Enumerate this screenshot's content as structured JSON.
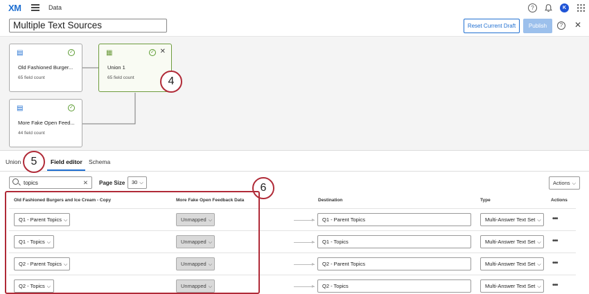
{
  "topbar": {
    "logo": "XM",
    "section": "Data",
    "avatar_initial": "K"
  },
  "header": {
    "title": "Multiple Text Sources",
    "reset_label": "Reset Current Draft",
    "publish_label": "Publish"
  },
  "nodes": [
    {
      "title": "Old Fashioned Burger...",
      "sub": "65 field count"
    },
    {
      "title": "Union 1",
      "sub": "65 field count"
    },
    {
      "title": "More Fake Open Feed...",
      "sub": "44 field count"
    }
  ],
  "callouts": {
    "c4": "4",
    "c5": "5",
    "c6": "6"
  },
  "tabs": {
    "union": "Union",
    "field_editor": "Field editor",
    "schema": "Schema"
  },
  "toolbar": {
    "search_value": "topics",
    "page_size_label": "Page Size",
    "page_size_value": "30",
    "actions_label": "Actions"
  },
  "table": {
    "headers": {
      "source1": "Old Fashioned Burgers and Ice Cream - Copy",
      "source2": "More Fake Open Feedback Data",
      "destination": "Destination",
      "type": "Type",
      "actions": "Actions"
    },
    "rows": [
      {
        "source1": "Q1 - Parent Topics",
        "source2": "Unmapped",
        "destination": "Q1 - Parent Topics",
        "type": "Multi-Answer Text Set"
      },
      {
        "source1": "Q1 - Topics",
        "source2": "Unmapped",
        "destination": "Q1 - Topics",
        "type": "Multi-Answer Text Set"
      },
      {
        "source1": "Q2 - Parent Topics",
        "source2": "Unmapped",
        "destination": "Q2 - Parent Topics",
        "type": "Multi-Answer Text Set"
      },
      {
        "source1": "Q2 - Topics",
        "source2": "Unmapped",
        "destination": "Q2 - Topics",
        "type": "Multi-Answer Text Set"
      }
    ]
  },
  "colors": {
    "accent": "#1f6fd1",
    "callout": "#b02a37",
    "selected_node": "#6d9b3d"
  }
}
